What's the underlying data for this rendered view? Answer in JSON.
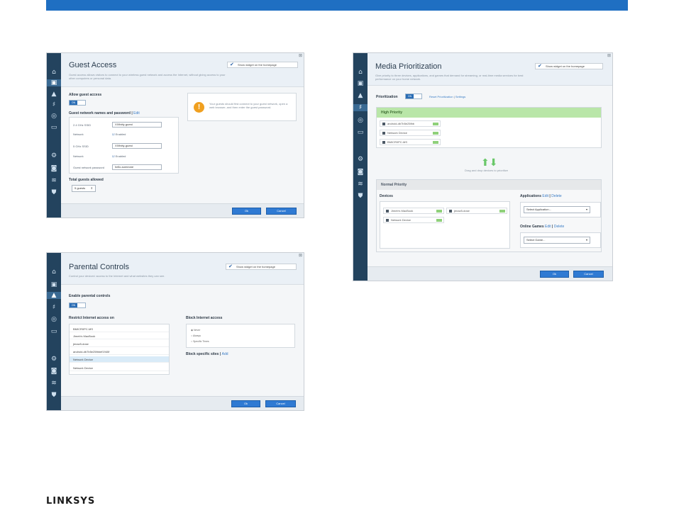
{
  "guest": {
    "title": "Guest Access",
    "description": "Guest access allows visitors to connect to your wireless guest network and access the Internet, without giving access to your other computers or personal data.",
    "widget_label": "Show widget on the homepage",
    "allow_label": "Allow guest access",
    "toggle": "ON",
    "names_label": "Guest network names and password",
    "edit": "Edit",
    "ghz24_label": "2.4 GHz SSID",
    "ghz24_value": "XXfinity-guest",
    "network_label": "Network",
    "enabled": "Enabled",
    "ghz5_label": "5 GHz SSID",
    "ghz5_value": "XXfinity-guest",
    "password_label": "Guest network password",
    "password_value": "hello-someone",
    "total_label": "Total guests allowed",
    "total_value": "5 guests",
    "info": "Your guests should first connect to your guest network, open a web browser, and then enter the guest password.",
    "ok": "Ok",
    "cancel": "Cancel"
  },
  "parental": {
    "title": "Parental Controls",
    "description": "Control your devices' access to the Internet and what websites they can see.",
    "widget_label": "Show widget on the homepage",
    "enable_label": "Enable parental controls",
    "toggle": "ON",
    "restrict_label": "Restrict Internet access on",
    "devices": [
      "BMICR0PC-MS",
      "Jimeb's MacBook",
      "jenaz5-dose",
      "android-db7b5e25fbbef1940f",
      "Network Device",
      "Network Device"
    ],
    "block_label": "Block Internet access",
    "radio_never": "Never",
    "radio_always": "Always",
    "radio_specific": "Specific Times",
    "sites_label": "Block specific sites",
    "add": "Add",
    "ok": "Ok",
    "cancel": "Cancel"
  },
  "media": {
    "title": "Media Prioritization",
    "description": "Give priority to three devices, applications, and games that demand for streaming, or real-time media services for best performance on your home network.",
    "widget_label": "Show widget on the homepage",
    "prio_label": "Prioritization",
    "toggle": "ON",
    "reset_link": "Reset Prioritization",
    "settings_link": "Settings",
    "high_label": "High Priority",
    "high_devices": [
      "android-db7b5e25fbb",
      "Network Device",
      "BMICR0PC-MS"
    ],
    "drag_text": "Drag and drop devices to prioritize",
    "normal_label": "Normal Priority",
    "devices_label": "Devices",
    "normal_devices": [
      "Jimeb's MacBook",
      "jenaz5-dose",
      "Network Device"
    ],
    "apps_label": "Applications",
    "apps_select": "Select Application...",
    "games_label": "Online Games",
    "games_select": "Select Game...",
    "edit": "Edit",
    "delete": "Delete",
    "ok": "Ok",
    "cancel": "Cancel"
  },
  "brand": {
    "logo": "LINKSYS",
    "bar_color": "#1f6fc2"
  }
}
